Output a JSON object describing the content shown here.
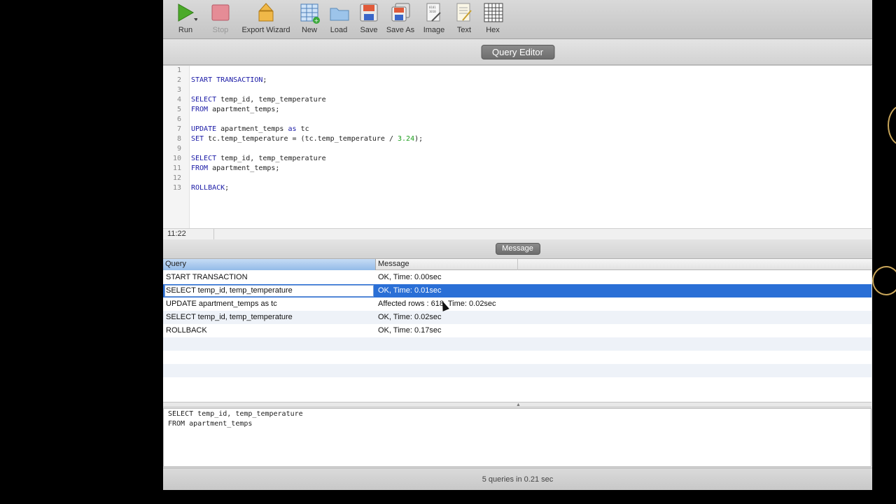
{
  "toolbar": {
    "buttons": [
      {
        "label": "Run",
        "icon": "play-icon"
      },
      {
        "label": "Stop",
        "icon": "stop-icon"
      },
      {
        "label": "Export Wizard",
        "icon": "export-wizard-icon"
      },
      {
        "label": "New",
        "icon": "new-table-icon"
      },
      {
        "label": "Load",
        "icon": "folder-icon"
      },
      {
        "label": "Save",
        "icon": "floppy-icon"
      },
      {
        "label": "Save As",
        "icon": "floppy-stack-icon"
      },
      {
        "label": "Image",
        "icon": "image-file-icon"
      },
      {
        "label": "Text",
        "icon": "text-file-icon"
      },
      {
        "label": "Hex",
        "icon": "hex-grid-icon"
      }
    ]
  },
  "query_editor": {
    "title": "Query Editor",
    "lines": [
      {
        "n": "1",
        "text": ""
      },
      {
        "n": "2",
        "text": "START TRANSACTION;"
      },
      {
        "n": "3",
        "text": ""
      },
      {
        "n": "4",
        "text": "SELECT temp_id, temp_temperature"
      },
      {
        "n": "5",
        "text": "FROM apartment_temps;"
      },
      {
        "n": "6",
        "text": ""
      },
      {
        "n": "7",
        "text": "UPDATE apartment_temps as tc"
      },
      {
        "n": "8",
        "text": "SET tc.temp_temperature = (tc.temp_temperature / 3.24);"
      },
      {
        "n": "9",
        "text": ""
      },
      {
        "n": "10",
        "text": "SELECT temp_id, temp_temperature"
      },
      {
        "n": "11",
        "text": "FROM apartment_temps;"
      },
      {
        "n": "12",
        "text": ""
      },
      {
        "n": "13",
        "text": "ROLLBACK;"
      }
    ],
    "cursor_position": "11:22"
  },
  "message_panel": {
    "title": "Message",
    "columns": [
      "Query",
      "Message"
    ],
    "rows": [
      {
        "query": "START TRANSACTION",
        "message": "OK, Time: 0.00sec"
      },
      {
        "query": "SELECT temp_id, temp_temperature",
        "message": "OK, Time: 0.01sec"
      },
      {
        "query": "UPDATE apartment_temps as tc",
        "message": "Affected rows : 618, Time: 0.02sec"
      },
      {
        "query": "SELECT temp_id, temp_temperature",
        "message": "OK, Time: 0.02sec"
      },
      {
        "query": "ROLLBACK",
        "message": "OK, Time: 0.17sec"
      }
    ],
    "selected_row": 1
  },
  "sql_preview": {
    "text": "SELECT temp_id, temp_temperature\nFROM apartment_temps"
  },
  "footer": {
    "summary": "5 queries in 0.21 sec"
  },
  "colors": {
    "selection": "#2a6fd6",
    "keyword": "#1a1aa6",
    "number": "#1c9e1c"
  }
}
